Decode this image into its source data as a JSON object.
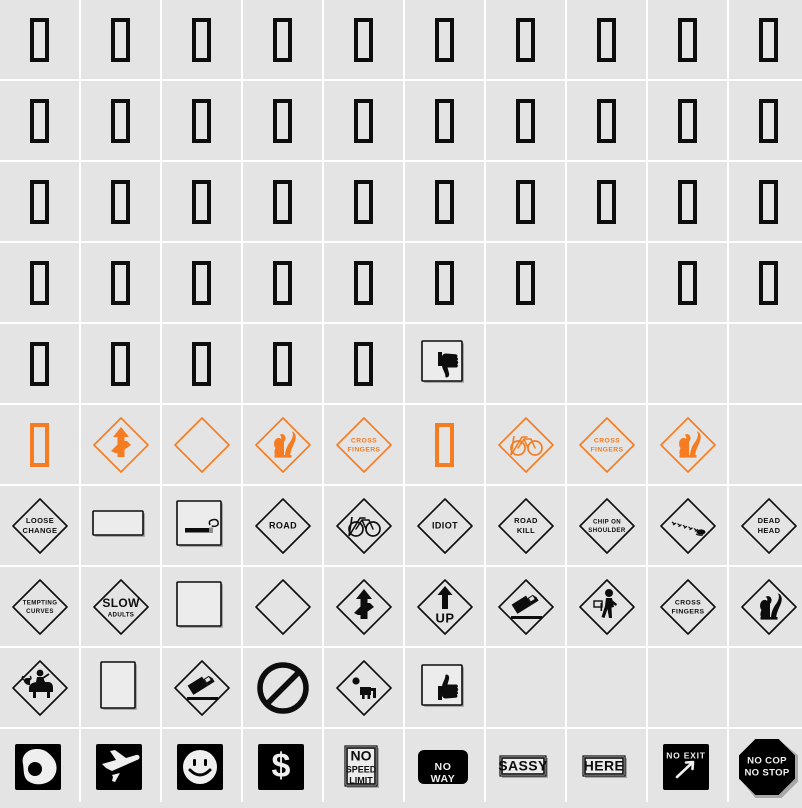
{
  "page": {
    "title": "Font character map grid",
    "background_color": "#e4e4e4",
    "grid_line_color": "#ffffff",
    "columns": 10,
    "rows": 10,
    "cell_size_px": 80
  },
  "palette": {
    "ink_black": "#0d0d0d",
    "sign_orange": "#f57c20",
    "sign_face": "#e4e4e4",
    "shadow": "#a8a8a8",
    "white": "#ffffff"
  },
  "cells": [
    {
      "row": 1,
      "col": 1,
      "kind": "tofu",
      "color": "ink_black",
      "label": "missing-glyph"
    },
    {
      "row": 1,
      "col": 2,
      "kind": "tofu",
      "color": "ink_black",
      "label": "missing-glyph"
    },
    {
      "row": 1,
      "col": 3,
      "kind": "tofu",
      "color": "ink_black",
      "label": "missing-glyph"
    },
    {
      "row": 1,
      "col": 4,
      "kind": "tofu",
      "color": "ink_black",
      "label": "missing-glyph"
    },
    {
      "row": 1,
      "col": 5,
      "kind": "tofu",
      "color": "ink_black",
      "label": "missing-glyph"
    },
    {
      "row": 1,
      "col": 6,
      "kind": "tofu",
      "color": "ink_black",
      "label": "missing-glyph"
    },
    {
      "row": 1,
      "col": 7,
      "kind": "tofu",
      "color": "ink_black",
      "label": "missing-glyph"
    },
    {
      "row": 1,
      "col": 8,
      "kind": "tofu",
      "color": "ink_black",
      "label": "missing-glyph"
    },
    {
      "row": 1,
      "col": 9,
      "kind": "tofu",
      "color": "ink_black",
      "label": "missing-glyph"
    },
    {
      "row": 1,
      "col": 10,
      "kind": "tofu",
      "color": "ink_black",
      "label": "missing-glyph"
    },
    {
      "row": 2,
      "col": 1,
      "kind": "tofu",
      "color": "ink_black",
      "label": "missing-glyph"
    },
    {
      "row": 2,
      "col": 2,
      "kind": "tofu",
      "color": "ink_black",
      "label": "missing-glyph"
    },
    {
      "row": 2,
      "col": 3,
      "kind": "tofu",
      "color": "ink_black",
      "label": "missing-glyph"
    },
    {
      "row": 2,
      "col": 4,
      "kind": "tofu",
      "color": "ink_black",
      "label": "missing-glyph"
    },
    {
      "row": 2,
      "col": 5,
      "kind": "tofu",
      "color": "ink_black",
      "label": "missing-glyph"
    },
    {
      "row": 2,
      "col": 6,
      "kind": "tofu",
      "color": "ink_black",
      "label": "missing-glyph"
    },
    {
      "row": 2,
      "col": 7,
      "kind": "tofu",
      "color": "ink_black",
      "label": "missing-glyph"
    },
    {
      "row": 2,
      "col": 8,
      "kind": "tofu",
      "color": "ink_black",
      "label": "missing-glyph"
    },
    {
      "row": 2,
      "col": 9,
      "kind": "tofu",
      "color": "ink_black",
      "label": "missing-glyph"
    },
    {
      "row": 2,
      "col": 10,
      "kind": "tofu",
      "color": "ink_black",
      "label": "missing-glyph"
    },
    {
      "row": 3,
      "col": 1,
      "kind": "tofu",
      "color": "ink_black",
      "label": "missing-glyph"
    },
    {
      "row": 3,
      "col": 2,
      "kind": "tofu",
      "color": "ink_black",
      "label": "missing-glyph"
    },
    {
      "row": 3,
      "col": 3,
      "kind": "tofu",
      "color": "ink_black",
      "label": "missing-glyph"
    },
    {
      "row": 3,
      "col": 4,
      "kind": "tofu",
      "color": "ink_black",
      "label": "missing-glyph"
    },
    {
      "row": 3,
      "col": 5,
      "kind": "tofu",
      "color": "ink_black",
      "label": "missing-glyph"
    },
    {
      "row": 3,
      "col": 6,
      "kind": "tofu",
      "color": "ink_black",
      "label": "missing-glyph"
    },
    {
      "row": 3,
      "col": 7,
      "kind": "tofu",
      "color": "ink_black",
      "label": "missing-glyph"
    },
    {
      "row": 3,
      "col": 8,
      "kind": "tofu",
      "color": "ink_black",
      "label": "missing-glyph"
    },
    {
      "row": 3,
      "col": 9,
      "kind": "tofu",
      "color": "ink_black",
      "label": "missing-glyph"
    },
    {
      "row": 3,
      "col": 10,
      "kind": "tofu",
      "color": "ink_black",
      "label": "missing-glyph"
    },
    {
      "row": 4,
      "col": 1,
      "kind": "tofu",
      "color": "ink_black",
      "label": "missing-glyph"
    },
    {
      "row": 4,
      "col": 2,
      "kind": "tofu",
      "color": "ink_black",
      "label": "missing-glyph"
    },
    {
      "row": 4,
      "col": 3,
      "kind": "tofu",
      "color": "ink_black",
      "label": "missing-glyph"
    },
    {
      "row": 4,
      "col": 4,
      "kind": "tofu",
      "color": "ink_black",
      "label": "missing-glyph"
    },
    {
      "row": 4,
      "col": 5,
      "kind": "tofu",
      "color": "ink_black",
      "label": "missing-glyph"
    },
    {
      "row": 4,
      "col": 6,
      "kind": "tofu",
      "color": "ink_black",
      "label": "missing-glyph"
    },
    {
      "row": 4,
      "col": 7,
      "kind": "tofu",
      "color": "ink_black",
      "label": "missing-glyph"
    },
    {
      "row": 4,
      "col": 8,
      "kind": "empty",
      "label": "blank-cell"
    },
    {
      "row": 4,
      "col": 9,
      "kind": "tofu",
      "color": "ink_black",
      "label": "missing-glyph"
    },
    {
      "row": 4,
      "col": 10,
      "kind": "tofu",
      "color": "ink_black",
      "label": "missing-glyph"
    },
    {
      "row": 5,
      "col": 1,
      "kind": "tofu",
      "color": "ink_black",
      "label": "missing-glyph"
    },
    {
      "row": 5,
      "col": 2,
      "kind": "tofu",
      "color": "ink_black",
      "label": "missing-glyph"
    },
    {
      "row": 5,
      "col": 3,
      "kind": "tofu",
      "color": "ink_black",
      "label": "missing-glyph"
    },
    {
      "row": 5,
      "col": 4,
      "kind": "tofu",
      "color": "ink_black",
      "label": "missing-glyph"
    },
    {
      "row": 5,
      "col": 5,
      "kind": "tofu",
      "color": "ink_black",
      "label": "missing-glyph"
    },
    {
      "row": 5,
      "col": 6,
      "kind": "plate-thumb-down",
      "color": "ink_black",
      "label": "thumbs-down-plate"
    },
    {
      "row": 5,
      "col": 7,
      "kind": "empty",
      "label": "blank-cell"
    },
    {
      "row": 5,
      "col": 8,
      "kind": "empty",
      "label": "blank-cell"
    },
    {
      "row": 5,
      "col": 9,
      "kind": "empty",
      "label": "blank-cell"
    },
    {
      "row": 5,
      "col": 10,
      "kind": "empty",
      "label": "blank-cell"
    },
    {
      "row": 6,
      "col": 1,
      "kind": "tofu",
      "color": "sign_orange",
      "label": "missing-glyph-orange"
    },
    {
      "row": 6,
      "col": 2,
      "kind": "diamond-winding-arrow",
      "color": "sign_orange",
      "label": "winding-road-arrow-sign"
    },
    {
      "row": 6,
      "col": 3,
      "kind": "diamond-blank",
      "color": "sign_orange",
      "label": "blank-diamond-sign"
    },
    {
      "row": 6,
      "col": 4,
      "kind": "diamond-squirrel",
      "color": "sign_orange",
      "label": "squirrel-crossing-sign"
    },
    {
      "row": 6,
      "col": 5,
      "kind": "diamond-text",
      "color": "sign_orange",
      "text": [
        "CROSS",
        "FINGERS"
      ],
      "label": "cross-fingers-sign"
    },
    {
      "row": 6,
      "col": 6,
      "kind": "tofu",
      "color": "sign_orange",
      "label": "missing-glyph-orange"
    },
    {
      "row": 6,
      "col": 7,
      "kind": "diamond-no-bicycle",
      "color": "sign_orange",
      "label": "no-bicycle-sign"
    },
    {
      "row": 6,
      "col": 8,
      "kind": "diamond-text",
      "color": "sign_orange",
      "text": [
        "CROSS",
        "FINGERS"
      ],
      "label": "cross-fingers-sign"
    },
    {
      "row": 6,
      "col": 9,
      "kind": "diamond-squirrel",
      "color": "sign_orange",
      "label": "squirrel-crossing-sign"
    },
    {
      "row": 6,
      "col": 10,
      "kind": "empty",
      "label": "blank-cell"
    },
    {
      "row": 7,
      "col": 1,
      "kind": "diamond-text",
      "color": "ink_black",
      "text": [
        "LOOSE",
        "CHANGE"
      ],
      "label": "loose-change-sign"
    },
    {
      "row": 7,
      "col": 2,
      "kind": "plate-wide-blank",
      "color": "ink_black",
      "label": "blank-wide-plate"
    },
    {
      "row": 7,
      "col": 3,
      "kind": "plate-cigarette",
      "color": "ink_black",
      "label": "cigarette-plate"
    },
    {
      "row": 7,
      "col": 4,
      "kind": "diamond-text",
      "color": "ink_black",
      "text": [
        "ROAD"
      ],
      "label": "road-sign"
    },
    {
      "row": 7,
      "col": 5,
      "kind": "diamond-no-bicycle",
      "color": "ink_black",
      "label": "no-bicycle-sign"
    },
    {
      "row": 7,
      "col": 6,
      "kind": "diamond-text",
      "color": "ink_black",
      "text": [
        "IDIOT"
      ],
      "label": "idiot-sign"
    },
    {
      "row": 7,
      "col": 7,
      "kind": "diamond-text",
      "color": "ink_black",
      "text": [
        "ROAD",
        "KILL"
      ],
      "label": "road-kill-sign"
    },
    {
      "row": 7,
      "col": 8,
      "kind": "diamond-text",
      "color": "ink_black",
      "text": [
        "CHIP ON",
        "SHOULDER"
      ],
      "label": "chip-on-shoulder-sign"
    },
    {
      "row": 7,
      "col": 9,
      "kind": "diamond-skidmarks",
      "color": "ink_black",
      "label": "skid-marks-sign"
    },
    {
      "row": 7,
      "col": 10,
      "kind": "diamond-text",
      "color": "ink_black",
      "text": [
        "DEAD",
        "HEAD"
      ],
      "label": "dead-head-sign"
    },
    {
      "row": 8,
      "col": 1,
      "kind": "diamond-text",
      "color": "ink_black",
      "text": [
        "TEMPTING",
        "CURVES"
      ],
      "label": "tempting-curves-sign"
    },
    {
      "row": 8,
      "col": 2,
      "kind": "diamond-text-2size",
      "color": "ink_black",
      "text": [
        "SLOW",
        "ADULTS"
      ],
      "label": "slow-adults-sign"
    },
    {
      "row": 8,
      "col": 3,
      "kind": "plate-square-blank",
      "color": "ink_black",
      "label": "blank-square-plate"
    },
    {
      "row": 8,
      "col": 4,
      "kind": "diamond-blank",
      "color": "ink_black",
      "label": "blank-diamond-sign"
    },
    {
      "row": 8,
      "col": 5,
      "kind": "diamond-winding-arrow",
      "color": "ink_black",
      "label": "winding-road-arrow-sign"
    },
    {
      "row": 8,
      "col": 6,
      "kind": "diamond-up-arrow",
      "color": "ink_black",
      "text": [
        "UP"
      ],
      "label": "up-arrow-sign"
    },
    {
      "row": 8,
      "col": 7,
      "kind": "diamond-truck-tip",
      "color": "ink_black",
      "label": "tipping-truck-sign"
    },
    {
      "row": 8,
      "col": 8,
      "kind": "diamond-pedestrian",
      "color": "ink_black",
      "label": "pedestrian-crossing-sign"
    },
    {
      "row": 8,
      "col": 9,
      "kind": "diamond-text",
      "color": "ink_black",
      "text": [
        "CROSS",
        "FINGERS"
      ],
      "label": "cross-fingers-sign"
    },
    {
      "row": 8,
      "col": 10,
      "kind": "diamond-squirrel",
      "color": "ink_black",
      "label": "squirrel-crossing-sign"
    },
    {
      "row": 9,
      "col": 1,
      "kind": "diamond-bull-rider",
      "color": "ink_black",
      "label": "bull-rider-sign"
    },
    {
      "row": 9,
      "col": 2,
      "kind": "plate-tall-blank",
      "color": "ink_black",
      "label": "blank-tall-plate"
    },
    {
      "row": 9,
      "col": 3,
      "kind": "diamond-truck-tip",
      "color": "ink_black",
      "label": "tipping-truck-sign"
    },
    {
      "row": 9,
      "col": 4,
      "kind": "prohibition-circle",
      "color": "ink_black",
      "label": "prohibition-sign"
    },
    {
      "row": 9,
      "col": 5,
      "kind": "diamond-crawler",
      "color": "ink_black",
      "label": "crawling-figure-sign"
    },
    {
      "row": 9,
      "col": 6,
      "kind": "plate-thumb-up",
      "color": "ink_black",
      "label": "thumbs-up-plate"
    },
    {
      "row": 9,
      "col": 7,
      "kind": "empty",
      "label": "blank-cell"
    },
    {
      "row": 9,
      "col": 8,
      "kind": "empty",
      "label": "blank-cell"
    },
    {
      "row": 9,
      "col": 9,
      "kind": "empty",
      "label": "blank-cell"
    },
    {
      "row": 9,
      "col": 10,
      "kind": "empty",
      "label": "blank-cell"
    },
    {
      "row": 10,
      "col": 1,
      "kind": "black-square-egg",
      "color": "ink_black",
      "label": "fried-egg-plate"
    },
    {
      "row": 10,
      "col": 2,
      "kind": "black-square-plane",
      "color": "ink_black",
      "label": "airplane-plate"
    },
    {
      "row": 10,
      "col": 3,
      "kind": "black-square-smiley",
      "color": "ink_black",
      "label": "smiley-face-plate"
    },
    {
      "row": 10,
      "col": 4,
      "kind": "black-square-dollar",
      "color": "ink_black",
      "label": "dollar-sign-plate"
    },
    {
      "row": 10,
      "col": 5,
      "kind": "white-plate-text3",
      "color": "ink_black",
      "text": [
        "NO",
        "SPEED",
        "LIMIT"
      ],
      "label": "no-speed-limit-sign"
    },
    {
      "row": 10,
      "col": 6,
      "kind": "black-rounded-text",
      "color": "ink_black",
      "text": [
        "NO",
        "WAY"
      ],
      "label": "no-way-sign"
    },
    {
      "row": 10,
      "col": 7,
      "kind": "white-plate-text1",
      "color": "ink_black",
      "text": [
        "SASSY"
      ],
      "label": "sassy-sign"
    },
    {
      "row": 10,
      "col": 8,
      "kind": "white-plate-text1",
      "color": "ink_black",
      "text": [
        "HERE"
      ],
      "label": "here-sign"
    },
    {
      "row": 10,
      "col": 9,
      "kind": "black-square-no-exit",
      "color": "ink_black",
      "text": [
        "NO EXIT"
      ],
      "label": "no-exit-arrow-sign"
    },
    {
      "row": 10,
      "col": 10,
      "kind": "octagon-text",
      "color": "ink_black",
      "text": [
        "NO COP",
        "NO STOP"
      ],
      "label": "no-cop-no-stop-sign"
    }
  ]
}
